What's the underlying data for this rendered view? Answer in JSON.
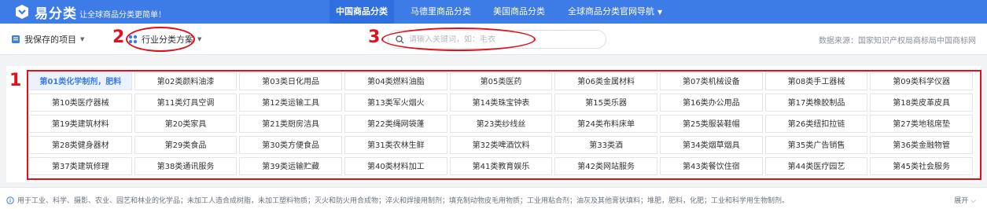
{
  "header": {
    "brand": "易分类",
    "slogan": "让全球商品分类更简单！",
    "nav": [
      {
        "label": "中国商品分类",
        "active": true
      },
      {
        "label": "马德里商品分类",
        "active": false
      },
      {
        "label": "美国商品分类",
        "active": false
      },
      {
        "label": "全球商品分类官网导航",
        "active": false
      }
    ],
    "accent": "#3d7be6"
  },
  "toolbar": {
    "saved_label": "我保存的项目",
    "scheme_label": "行业分类方案",
    "search_placeholder": "请输入关键词，如：毛衣",
    "data_source": "数据来源：国家知识产权局商标局中国商标网"
  },
  "annotations": [
    "1",
    "2",
    "3"
  ],
  "categories": [
    "第01类化学制剂，肥料",
    "第02类颜料油漆",
    "第03类日化用品",
    "第04类燃料油脂",
    "第05类医药",
    "第06类金属材料",
    "第07类机械设备",
    "第08类手工器械",
    "第09类科学仪器",
    "第10类医疗器械",
    "第11类灯具空调",
    "第12类运输工具",
    "第13类军火烟火",
    "第14类珠宝钟表",
    "第15类乐器",
    "第16类办公用品",
    "第17类橡胶制品",
    "第18类皮革皮具",
    "第19类建筑材料",
    "第20类家具",
    "第21类厨房洁具",
    "第22类绳网袋蓬",
    "第23类纱线丝",
    "第24类布料床单",
    "第25类服装鞋帽",
    "第26类纽扣拉链",
    "第27类地毯席垫",
    "第28类健身器材",
    "第29类食品",
    "第30类方便食品",
    "第31类农林生鲜",
    "第32类啤酒饮料",
    "第33类酒",
    "第34类烟草烟具",
    "第35类广告销售",
    "第36类金融物管",
    "第37类建筑修理",
    "第38类通讯服务",
    "第39类运输贮藏",
    "第40类材料加工",
    "第41类教育娱乐",
    "第42类网站服务",
    "第43类餐饮住宿",
    "第44类医疗园艺",
    "第45类社会服务"
  ],
  "selected_category": 0,
  "description": "用于工业、科学、摄影、农业、园艺和林业的化学品；未加工人造合成树脂，未加工塑料物质；灭火和防火用合成物；淬火和焊接用制剂；填充制动物皮毛用物质；工业用粘合剂；油灰及其他膏状填料；堆肥，肥料，化肥；工业和科学用生物制剂。",
  "expand_label": "展开"
}
